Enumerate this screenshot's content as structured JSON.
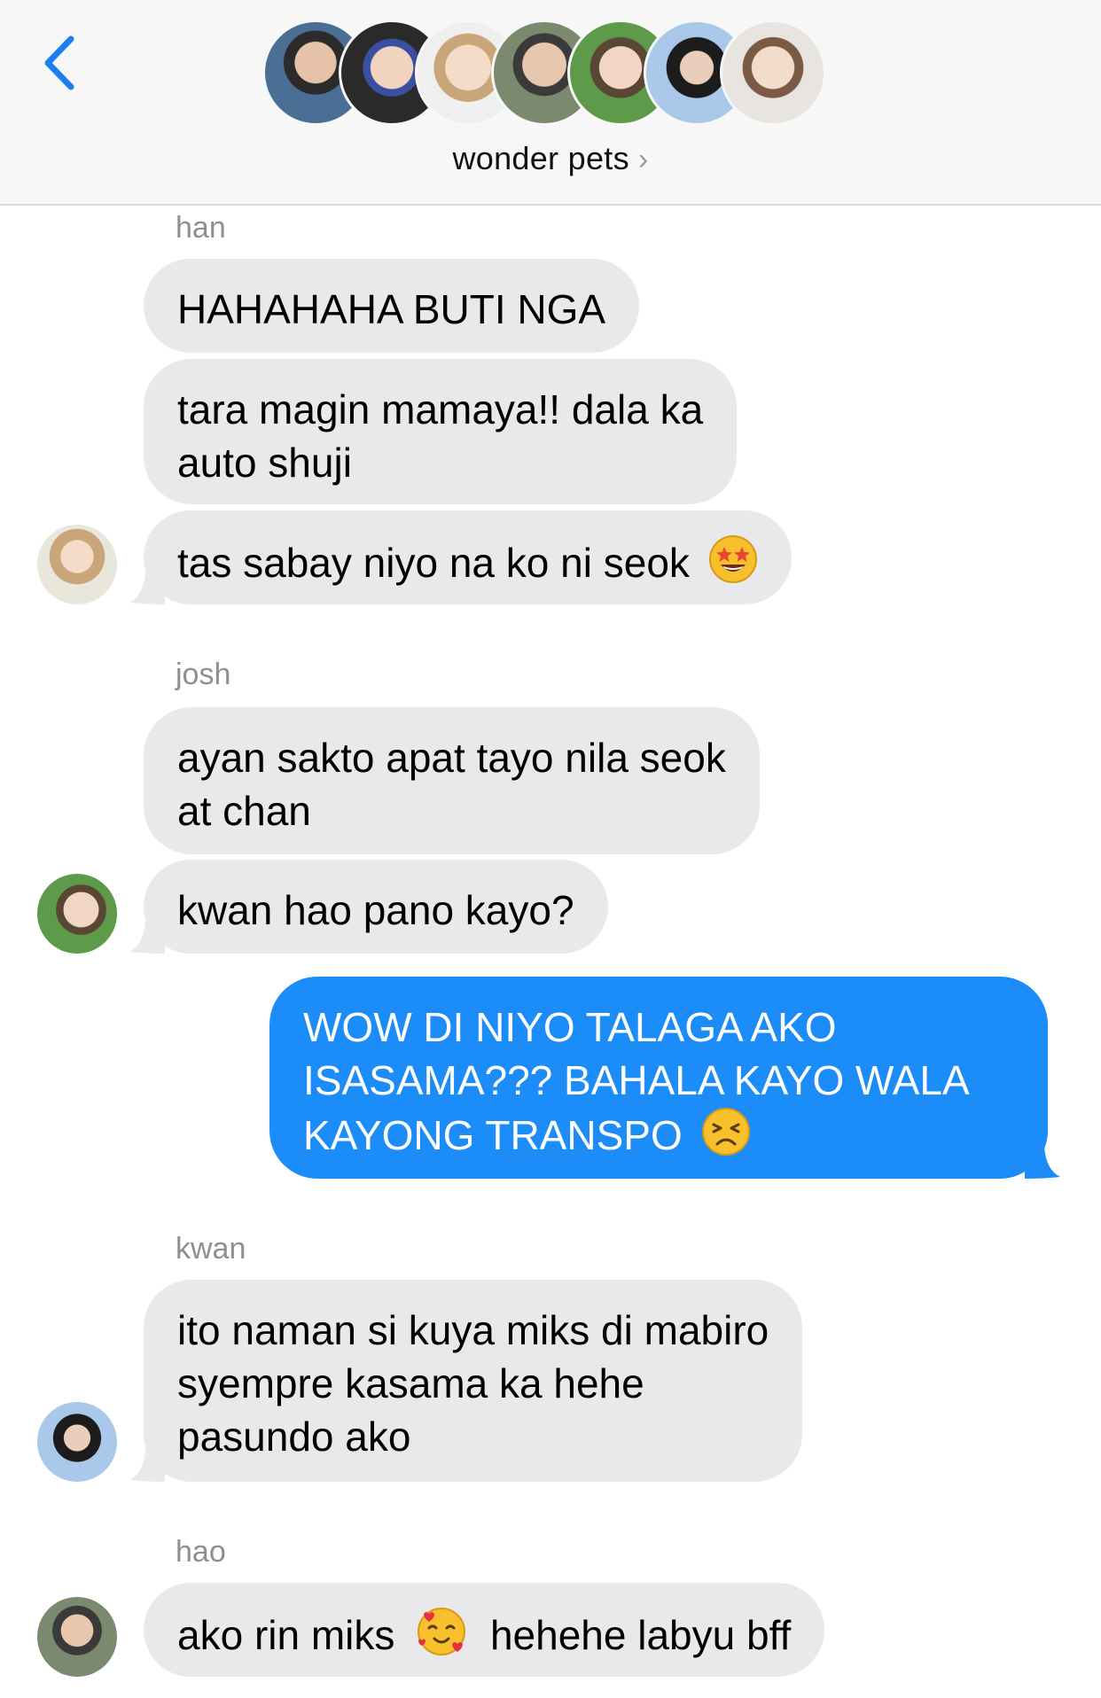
{
  "header": {
    "back_icon": "chevron-left-icon",
    "group_name": "wonder pets",
    "group_chevron": "›",
    "participant_count": 7
  },
  "messages": [
    {
      "sender": "han"
    },
    {
      "text": "HAHAHAHA BUTI NGA"
    },
    {
      "line1": "tara magin mamaya!! dala ka",
      "line2": "auto shuji"
    },
    {
      "text": "tas sabay niyo na ko ni seok",
      "emoji": "star-struck-emoji"
    },
    {
      "sender": "josh"
    },
    {
      "line1": "ayan sakto apat tayo nila seok",
      "line2": "at chan"
    },
    {
      "text": "kwan hao pano kayo?"
    },
    {
      "line1": "WOW DI NIYO TALAGA AKO",
      "line2": "ISASAMA??? BAHALA KAYO WALA",
      "line3": "KAYONG TRANSPO",
      "emoji": "persevering-face-emoji"
    },
    {
      "sender": "kwan"
    },
    {
      "line1": "ito naman si kuya miks di mabiro",
      "line2": "syempre kasama ka hehe",
      "line3": "pasundo ako"
    },
    {
      "sender": "hao"
    },
    {
      "text_before": "ako rin miks",
      "emoji": "smiling-face-with-hearts-emoji",
      "text_after": "hehehe labyu bff"
    }
  ],
  "colors": {
    "incoming_bubble": "#e9e9eb",
    "outgoing_bubble": "#1b8cf8",
    "accent": "#1b7ff2",
    "sender_label": "#8e8e93"
  }
}
